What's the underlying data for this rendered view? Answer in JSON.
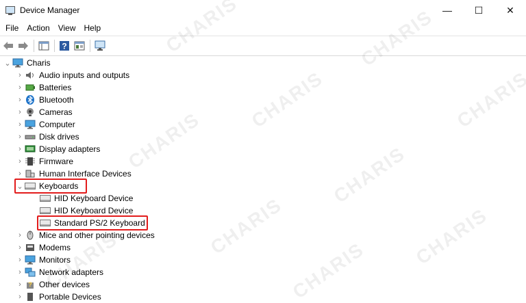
{
  "window": {
    "title": "Device Manager",
    "controls": [
      "—",
      "☐",
      "✕"
    ]
  },
  "menu": [
    "File",
    "Action",
    "View",
    "Help"
  ],
  "tree": {
    "root": "Charis",
    "items": [
      {
        "label": "Audio inputs and outputs",
        "icon": "speaker-icon"
      },
      {
        "label": "Batteries",
        "icon": "battery-icon"
      },
      {
        "label": "Bluetooth",
        "icon": "bluetooth-icon"
      },
      {
        "label": "Cameras",
        "icon": "camera-icon"
      },
      {
        "label": "Computer",
        "icon": "computer-icon"
      },
      {
        "label": "Disk drives",
        "icon": "disk-drive-icon"
      },
      {
        "label": "Display adapters",
        "icon": "display-adapter-icon"
      },
      {
        "label": "Firmware",
        "icon": "firmware-icon"
      },
      {
        "label": "Human Interface Devices",
        "icon": "hid-icon"
      },
      {
        "label": "Keyboards",
        "icon": "keyboard-icon",
        "expanded": true
      },
      {
        "label": "Mice and other pointing devices",
        "icon": "mouse-icon"
      },
      {
        "label": "Modems",
        "icon": "modem-icon"
      },
      {
        "label": "Monitors",
        "icon": "monitor-icon"
      },
      {
        "label": "Network adapters",
        "icon": "network-adapter-icon"
      },
      {
        "label": "Other devices",
        "icon": "other-devices-icon"
      },
      {
        "label": "Portable Devices",
        "icon": "portable-device-icon"
      }
    ],
    "keyboard_children": [
      "HID Keyboard Device",
      "HID Keyboard Device",
      "Standard PS/2 Keyboard"
    ]
  },
  "watermark": "CHARIS",
  "highlight_color": "#e21b1b"
}
